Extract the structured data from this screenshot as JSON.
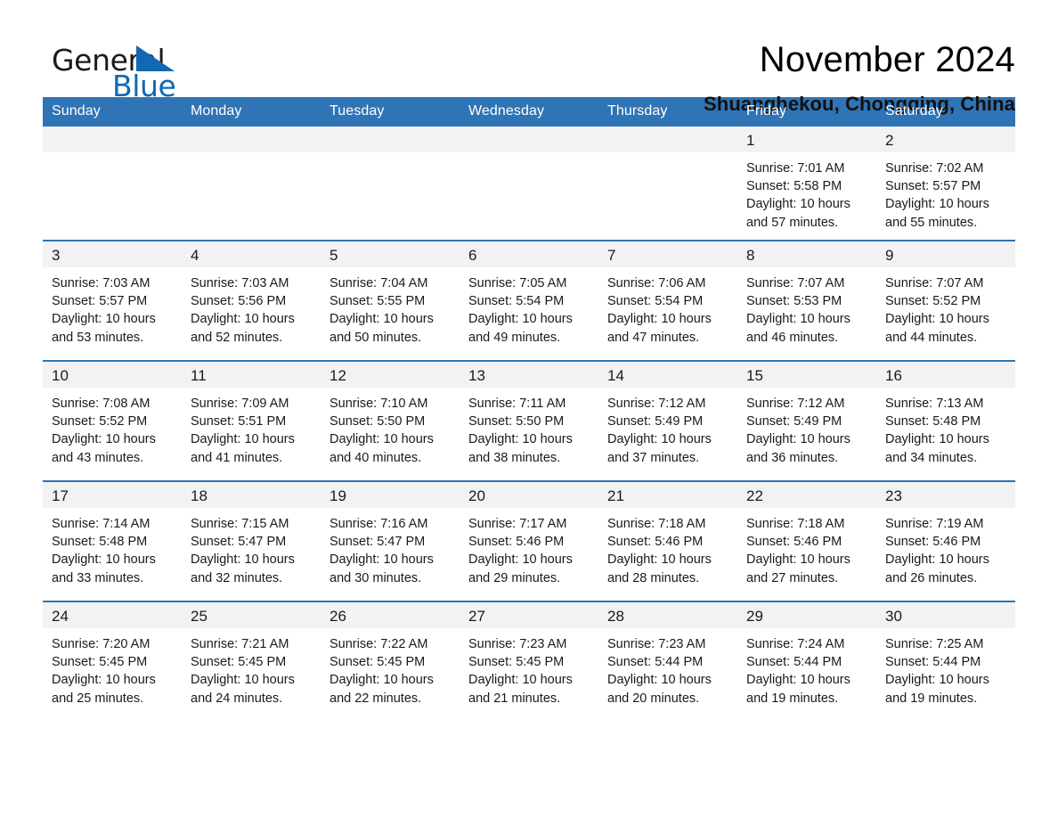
{
  "brand": {
    "name_part1": "General",
    "name_part2": "Blue",
    "triangle_color": "#1168b3"
  },
  "header": {
    "month_title": "November 2024",
    "location": "Shuanghekou, Chongqing, China"
  },
  "theme": {
    "header_blue": "#2f74b5",
    "day_band_gray": "#f2f2f2",
    "text_color": "#1a1a1a"
  },
  "weekday_headers": [
    "Sunday",
    "Monday",
    "Tuesday",
    "Wednesday",
    "Thursday",
    "Friday",
    "Saturday"
  ],
  "labels": {
    "sunrise_prefix": "Sunrise:",
    "sunset_prefix": "Sunset:",
    "daylight_prefix": "Daylight:"
  },
  "weeks": [
    [
      {
        "day": "",
        "empty": true
      },
      {
        "day": "",
        "empty": true
      },
      {
        "day": "",
        "empty": true
      },
      {
        "day": "",
        "empty": true
      },
      {
        "day": "",
        "empty": true
      },
      {
        "day": "1",
        "sunrise": "Sunrise: 7:01 AM",
        "sunset": "Sunset: 5:58 PM",
        "daylight_line1": "Daylight: 10 hours",
        "daylight_line2": "and 57 minutes."
      },
      {
        "day": "2",
        "sunrise": "Sunrise: 7:02 AM",
        "sunset": "Sunset: 5:57 PM",
        "daylight_line1": "Daylight: 10 hours",
        "daylight_line2": "and 55 minutes."
      }
    ],
    [
      {
        "day": "3",
        "sunrise": "Sunrise: 7:03 AM",
        "sunset": "Sunset: 5:57 PM",
        "daylight_line1": "Daylight: 10 hours",
        "daylight_line2": "and 53 minutes."
      },
      {
        "day": "4",
        "sunrise": "Sunrise: 7:03 AM",
        "sunset": "Sunset: 5:56 PM",
        "daylight_line1": "Daylight: 10 hours",
        "daylight_line2": "and 52 minutes."
      },
      {
        "day": "5",
        "sunrise": "Sunrise: 7:04 AM",
        "sunset": "Sunset: 5:55 PM",
        "daylight_line1": "Daylight: 10 hours",
        "daylight_line2": "and 50 minutes."
      },
      {
        "day": "6",
        "sunrise": "Sunrise: 7:05 AM",
        "sunset": "Sunset: 5:54 PM",
        "daylight_line1": "Daylight: 10 hours",
        "daylight_line2": "and 49 minutes."
      },
      {
        "day": "7",
        "sunrise": "Sunrise: 7:06 AM",
        "sunset": "Sunset: 5:54 PM",
        "daylight_line1": "Daylight: 10 hours",
        "daylight_line2": "and 47 minutes."
      },
      {
        "day": "8",
        "sunrise": "Sunrise: 7:07 AM",
        "sunset": "Sunset: 5:53 PM",
        "daylight_line1": "Daylight: 10 hours",
        "daylight_line2": "and 46 minutes."
      },
      {
        "day": "9",
        "sunrise": "Sunrise: 7:07 AM",
        "sunset": "Sunset: 5:52 PM",
        "daylight_line1": "Daylight: 10 hours",
        "daylight_line2": "and 44 minutes."
      }
    ],
    [
      {
        "day": "10",
        "sunrise": "Sunrise: 7:08 AM",
        "sunset": "Sunset: 5:52 PM",
        "daylight_line1": "Daylight: 10 hours",
        "daylight_line2": "and 43 minutes."
      },
      {
        "day": "11",
        "sunrise": "Sunrise: 7:09 AM",
        "sunset": "Sunset: 5:51 PM",
        "daylight_line1": "Daylight: 10 hours",
        "daylight_line2": "and 41 minutes."
      },
      {
        "day": "12",
        "sunrise": "Sunrise: 7:10 AM",
        "sunset": "Sunset: 5:50 PM",
        "daylight_line1": "Daylight: 10 hours",
        "daylight_line2": "and 40 minutes."
      },
      {
        "day": "13",
        "sunrise": "Sunrise: 7:11 AM",
        "sunset": "Sunset: 5:50 PM",
        "daylight_line1": "Daylight: 10 hours",
        "daylight_line2": "and 38 minutes."
      },
      {
        "day": "14",
        "sunrise": "Sunrise: 7:12 AM",
        "sunset": "Sunset: 5:49 PM",
        "daylight_line1": "Daylight: 10 hours",
        "daylight_line2": "and 37 minutes."
      },
      {
        "day": "15",
        "sunrise": "Sunrise: 7:12 AM",
        "sunset": "Sunset: 5:49 PM",
        "daylight_line1": "Daylight: 10 hours",
        "daylight_line2": "and 36 minutes."
      },
      {
        "day": "16",
        "sunrise": "Sunrise: 7:13 AM",
        "sunset": "Sunset: 5:48 PM",
        "daylight_line1": "Daylight: 10 hours",
        "daylight_line2": "and 34 minutes."
      }
    ],
    [
      {
        "day": "17",
        "sunrise": "Sunrise: 7:14 AM",
        "sunset": "Sunset: 5:48 PM",
        "daylight_line1": "Daylight: 10 hours",
        "daylight_line2": "and 33 minutes."
      },
      {
        "day": "18",
        "sunrise": "Sunrise: 7:15 AM",
        "sunset": "Sunset: 5:47 PM",
        "daylight_line1": "Daylight: 10 hours",
        "daylight_line2": "and 32 minutes."
      },
      {
        "day": "19",
        "sunrise": "Sunrise: 7:16 AM",
        "sunset": "Sunset: 5:47 PM",
        "daylight_line1": "Daylight: 10 hours",
        "daylight_line2": "and 30 minutes."
      },
      {
        "day": "20",
        "sunrise": "Sunrise: 7:17 AM",
        "sunset": "Sunset: 5:46 PM",
        "daylight_line1": "Daylight: 10 hours",
        "daylight_line2": "and 29 minutes."
      },
      {
        "day": "21",
        "sunrise": "Sunrise: 7:18 AM",
        "sunset": "Sunset: 5:46 PM",
        "daylight_line1": "Daylight: 10 hours",
        "daylight_line2": "and 28 minutes."
      },
      {
        "day": "22",
        "sunrise": "Sunrise: 7:18 AM",
        "sunset": "Sunset: 5:46 PM",
        "daylight_line1": "Daylight: 10 hours",
        "daylight_line2": "and 27 minutes."
      },
      {
        "day": "23",
        "sunrise": "Sunrise: 7:19 AM",
        "sunset": "Sunset: 5:46 PM",
        "daylight_line1": "Daylight: 10 hours",
        "daylight_line2": "and 26 minutes."
      }
    ],
    [
      {
        "day": "24",
        "sunrise": "Sunrise: 7:20 AM",
        "sunset": "Sunset: 5:45 PM",
        "daylight_line1": "Daylight: 10 hours",
        "daylight_line2": "and 25 minutes."
      },
      {
        "day": "25",
        "sunrise": "Sunrise: 7:21 AM",
        "sunset": "Sunset: 5:45 PM",
        "daylight_line1": "Daylight: 10 hours",
        "daylight_line2": "and 24 minutes."
      },
      {
        "day": "26",
        "sunrise": "Sunrise: 7:22 AM",
        "sunset": "Sunset: 5:45 PM",
        "daylight_line1": "Daylight: 10 hours",
        "daylight_line2": "and 22 minutes."
      },
      {
        "day": "27",
        "sunrise": "Sunrise: 7:23 AM",
        "sunset": "Sunset: 5:45 PM",
        "daylight_line1": "Daylight: 10 hours",
        "daylight_line2": "and 21 minutes."
      },
      {
        "day": "28",
        "sunrise": "Sunrise: 7:23 AM",
        "sunset": "Sunset: 5:44 PM",
        "daylight_line1": "Daylight: 10 hours",
        "daylight_line2": "and 20 minutes."
      },
      {
        "day": "29",
        "sunrise": "Sunrise: 7:24 AM",
        "sunset": "Sunset: 5:44 PM",
        "daylight_line1": "Daylight: 10 hours",
        "daylight_line2": "and 19 minutes."
      },
      {
        "day": "30",
        "sunrise": "Sunrise: 7:25 AM",
        "sunset": "Sunset: 5:44 PM",
        "daylight_line1": "Daylight: 10 hours",
        "daylight_line2": "and 19 minutes."
      }
    ]
  ]
}
